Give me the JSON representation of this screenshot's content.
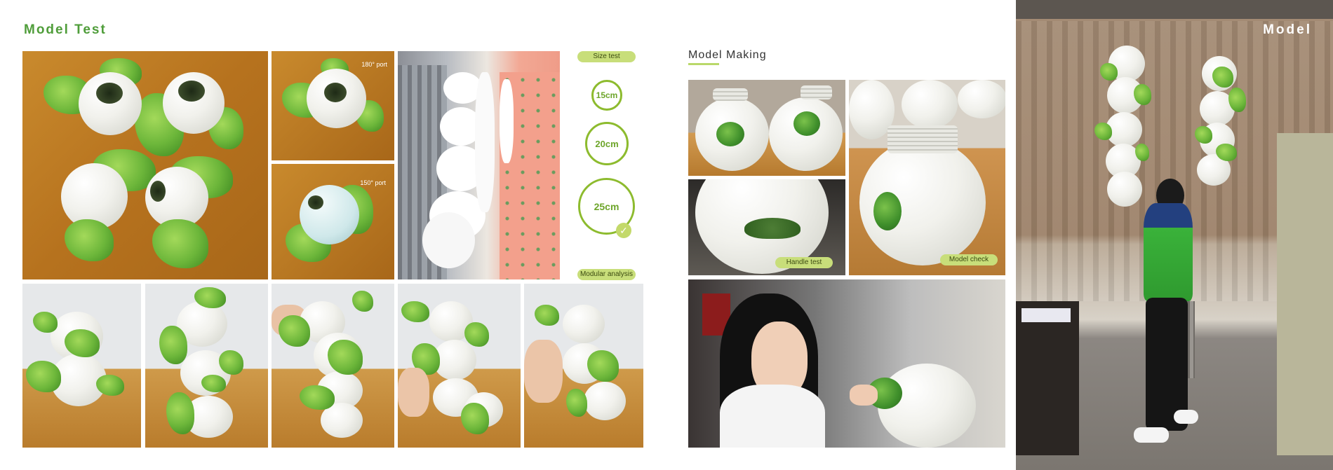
{
  "left_title": "Model Test",
  "middle_title": "Model Making",
  "right_title": "Model",
  "labels": {
    "port_180": "180° port",
    "port_150": "150° port",
    "size_test": "Size test",
    "modular_analysis": "Modular analysis",
    "handle_test": "Handle test",
    "model_check": "Model check"
  },
  "size_circles": [
    "15cm",
    "20cm",
    "25cm"
  ],
  "colors": {
    "accent_green": "#4f9d3a",
    "circle_stroke": "#8dbb2e",
    "pill_fill": "#c8de7a"
  }
}
